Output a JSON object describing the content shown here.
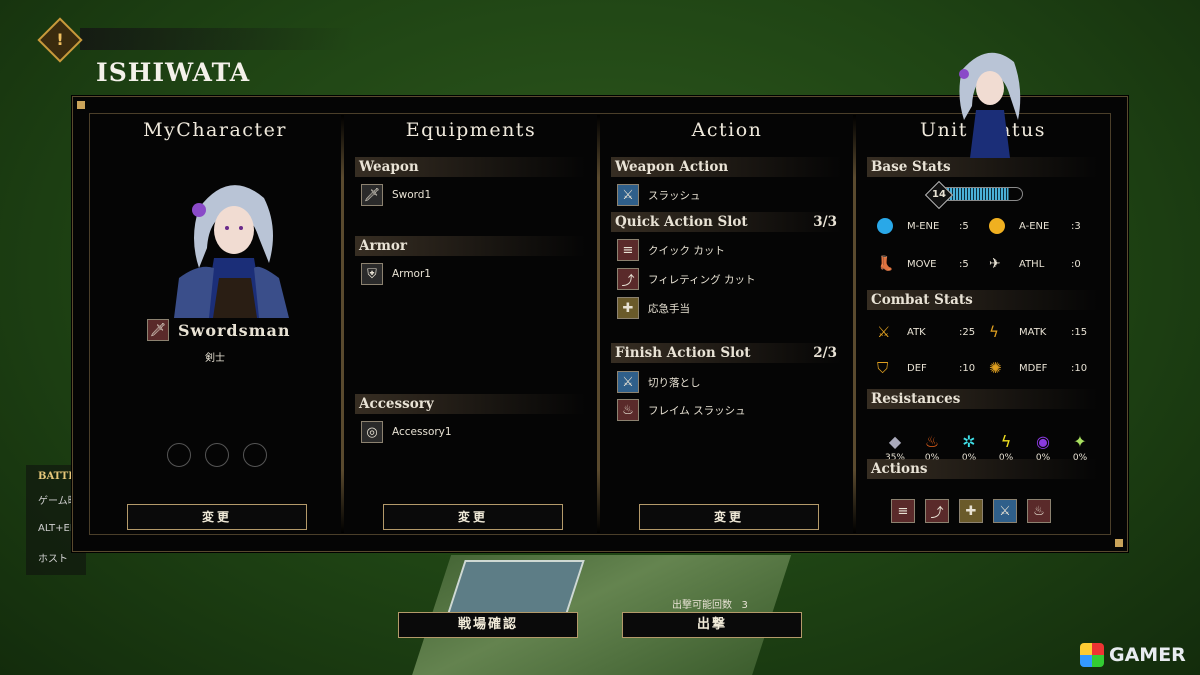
{
  "player_name": "ISHIWATA",
  "alert_icon": "exclamation-icon",
  "left_menu": {
    "title": "BATTI",
    "items": [
      "ゲーム時",
      "ALT+EN",
      "ホスト"
    ]
  },
  "my_character": {
    "title": "MyCharacter",
    "class_name": "Swordsman",
    "class_sub": "剣士",
    "button": "変更"
  },
  "equipments": {
    "title": "Equipments",
    "weapon_label": "Weapon",
    "weapon": "Sword1",
    "armor_label": "Armor",
    "armor": "Armor1",
    "accessory_label": "Accessory",
    "accessory": "Accessory1",
    "button": "変更"
  },
  "action": {
    "title": "Action",
    "weapon_action_label": "Weapon Action",
    "weapon_action": "スラッシュ",
    "quick_label": "Quick Action Slot",
    "quick_count": "3/3",
    "quick": [
      "クイック カット",
      "フィレティング カット",
      "応急手当"
    ],
    "finish_label": "Finish Action Slot",
    "finish_count": "2/3",
    "finish": [
      "切り落とし",
      "フレイム スラッシュ"
    ],
    "button": "変更"
  },
  "unit_status": {
    "title": "Unit Status",
    "base_label": "Base Stats",
    "level": "14",
    "level_fill": 0.85,
    "base": [
      {
        "name": "M-ENE",
        "value": ":5"
      },
      {
        "name": "A-ENE",
        "value": ":3"
      },
      {
        "name": "MOVE",
        "value": ":5"
      },
      {
        "name": "ATHL",
        "value": ":0"
      }
    ],
    "combat_label": "Combat Stats",
    "combat": [
      {
        "name": "ATK",
        "value": ":25"
      },
      {
        "name": "MATK",
        "value": ":15"
      },
      {
        "name": "DEF",
        "value": ":10"
      },
      {
        "name": "MDEF",
        "value": ":10"
      }
    ],
    "resist_label": "Resistances",
    "resist": [
      "35%",
      "0%",
      "0%",
      "0%",
      "0%",
      "0%"
    ],
    "actions_label": "Actions"
  },
  "sortie": {
    "label": "出撃可能回数",
    "value": "3"
  },
  "bottom": {
    "confirm": "戦場確認",
    "sortie": "出撃"
  },
  "watermark": "GAMER"
}
